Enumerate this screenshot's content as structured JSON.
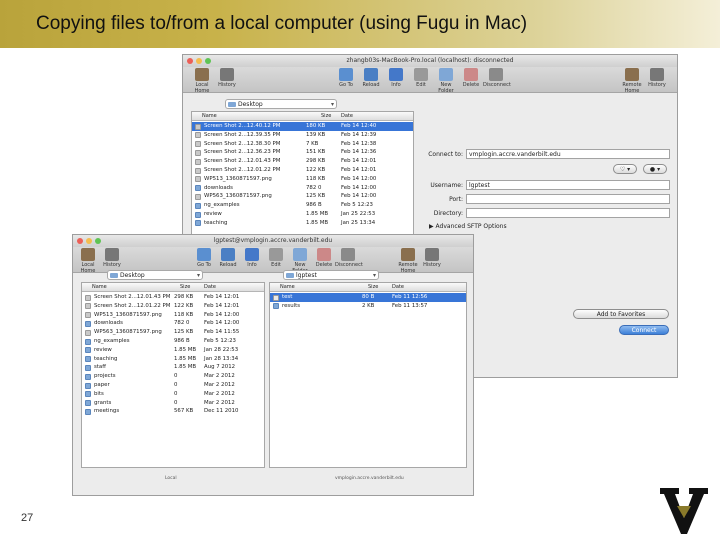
{
  "slide": {
    "title": "Copying files to/from a local computer (using Fugu in Mac)",
    "page_number": "27",
    "logo": "V"
  },
  "back_window": {
    "title": "zhangb03s-MacBook-Pro.local (localhost): disconnected",
    "toolbar_left": [
      {
        "label": "Local Home",
        "icon": "house-icon"
      },
      {
        "label": "History",
        "icon": "clock-icon"
      }
    ],
    "toolbar_mid": [
      {
        "label": "Go To",
        "icon": "goto-icon"
      },
      {
        "label": "Reload",
        "icon": "reload-icon"
      },
      {
        "label": "Info",
        "icon": "info-icon"
      },
      {
        "label": "Edit",
        "icon": "edit-icon"
      },
      {
        "label": "New Folder",
        "icon": "new-folder-icon"
      },
      {
        "label": "Delete",
        "icon": "delete-icon"
      },
      {
        "label": "Disconnect",
        "icon": "disconnect-icon"
      }
    ],
    "toolbar_right": [
      {
        "label": "Remote Home",
        "icon": "house-icon"
      },
      {
        "label": "History",
        "icon": "clock-icon"
      }
    ],
    "path": "Desktop",
    "columns": [
      "Name",
      "Size",
      "Date"
    ],
    "files": [
      {
        "name": "Screen Shot 2...12.40.12 PM",
        "size": "180 KB",
        "date": "Feb 14 12:40",
        "selected": true,
        "kind": "image"
      },
      {
        "name": "Screen Shot 2...12.39.35 PM",
        "size": "139 KB",
        "date": "Feb 14 12:39",
        "selected": false,
        "kind": "image"
      },
      {
        "name": "Screen Shot 2...12.38.30 PM",
        "size": "7 KB",
        "date": "Feb 14 12:38",
        "selected": false,
        "kind": "image"
      },
      {
        "name": "Screen Shot 2...12.36.23 PM",
        "size": "151 KB",
        "date": "Feb 14 12:36",
        "selected": false,
        "kind": "image"
      },
      {
        "name": "Screen Shot 2...12.01.43 PM",
        "size": "298 KB",
        "date": "Feb 14 12:01",
        "selected": false,
        "kind": "image"
      },
      {
        "name": "Screen Shot 2...12.01.22 PM",
        "size": "122 KB",
        "date": "Feb 14 12:01",
        "selected": false,
        "kind": "image"
      },
      {
        "name": "WP513_1360871597.png",
        "size": "118 KB",
        "date": "Feb 14 12:00",
        "selected": false,
        "kind": "image"
      },
      {
        "name": "downloads",
        "size": "782 0",
        "date": "Feb 14 12:00",
        "selected": false,
        "kind": "folder"
      },
      {
        "name": "WP563_1360871597.png",
        "size": "125 KB",
        "date": "Feb 14 12:00",
        "selected": false,
        "kind": "image"
      },
      {
        "name": "ng_examples",
        "size": "986 B",
        "date": "Feb 5 12:23",
        "selected": false,
        "kind": "folder"
      },
      {
        "name": "review",
        "size": "1.85 MB",
        "date": "Jan 25 22:53",
        "selected": false,
        "kind": "folder"
      },
      {
        "name": "teaching",
        "size": "1.85 MB",
        "date": "Jan 25 13:34",
        "selected": false,
        "kind": "folder"
      }
    ],
    "connect": {
      "connect_to_label": "Connect to:",
      "connect_to_value": "vmplogin.accre.vanderbilt.edu",
      "username_label": "Username:",
      "username_value": "lgptest",
      "port_label": "Port:",
      "port_value": "",
      "directory_label": "Directory:",
      "directory_value": "",
      "advanced_label": "Advanced SFTP Options",
      "add_favorites_label": "Add to Favorites",
      "connect_button_label": "Connect"
    }
  },
  "front_window": {
    "title": "lgptest@vmplogin.accre.vanderbilt.edu",
    "toolbar_left": [
      {
        "label": "Local Home",
        "icon": "house-icon"
      },
      {
        "label": "History",
        "icon": "clock-icon"
      }
    ],
    "toolbar_mid": [
      {
        "label": "Go To",
        "icon": "goto-icon"
      },
      {
        "label": "Reload",
        "icon": "reload-icon"
      },
      {
        "label": "Info",
        "icon": "info-icon"
      },
      {
        "label": "Edit",
        "icon": "edit-icon"
      },
      {
        "label": "New Folder",
        "icon": "new-folder-icon"
      },
      {
        "label": "Delete",
        "icon": "delete-icon"
      },
      {
        "label": "Disconnect",
        "icon": "disconnect-icon"
      }
    ],
    "toolbar_right": [
      {
        "label": "Remote Home",
        "icon": "house-icon"
      },
      {
        "label": "History",
        "icon": "clock-icon"
      }
    ],
    "local_path": "Desktop",
    "remote_path": "lgptest",
    "columns": [
      "Name",
      "Size",
      "Date"
    ],
    "local_files": [
      {
        "name": "Screen Shot 2...12.01.43 PM",
        "size": "298 KB",
        "date": "Feb 14 12:01",
        "kind": "image"
      },
      {
        "name": "Screen Shot 2...12.01.22 PM",
        "size": "122 KB",
        "date": "Feb 14 12:01",
        "kind": "image"
      },
      {
        "name": "WP513_1360871597.png",
        "size": "118 KB",
        "date": "Feb 14 12:00",
        "kind": "image"
      },
      {
        "name": "downloads",
        "size": "782 0",
        "date": "Feb 14 12:00",
        "kind": "folder"
      },
      {
        "name": "WP563_1360871597.png",
        "size": "125 KB",
        "date": "Feb 14 11:55",
        "kind": "image"
      },
      {
        "name": "ng_examples",
        "size": "986 B",
        "date": "Feb 5 12:23",
        "kind": "folder"
      },
      {
        "name": "review",
        "size": "1.85 MB",
        "date": "Jan 28 22:53",
        "kind": "folder"
      },
      {
        "name": "teaching",
        "size": "1.85 MB",
        "date": "Jan 28 13:34",
        "kind": "folder"
      },
      {
        "name": "staff",
        "size": "1.85 MB",
        "date": "Aug 7 2012",
        "kind": "folder"
      },
      {
        "name": "projects",
        "size": "0",
        "date": "Mar 2 2012",
        "kind": "folder"
      },
      {
        "name": "paper",
        "size": "0",
        "date": "Mar 2 2012",
        "kind": "folder"
      },
      {
        "name": "bits",
        "size": "0",
        "date": "Mar 2 2012",
        "kind": "folder"
      },
      {
        "name": "grants",
        "size": "0",
        "date": "Mar 2 2012",
        "kind": "folder"
      },
      {
        "name": "meetings",
        "size": "567 KB",
        "date": "Dec 11 2010",
        "kind": "folder"
      }
    ],
    "remote_files": [
      {
        "name": "test",
        "size": "80 B",
        "date": "Feb 11 12:56",
        "selected": true,
        "kind": "file"
      },
      {
        "name": "results",
        "size": "2 KB",
        "date": "Feb 11 13:57",
        "selected": false,
        "kind": "folder"
      }
    ],
    "local_footer": "Local",
    "remote_footer": "vmplogin.accre.vanderbilt.edu"
  },
  "colors": {
    "header_gold": "#b9a33b",
    "selection_blue": "#3875d7",
    "folder_blue": "#7fa7d6"
  }
}
